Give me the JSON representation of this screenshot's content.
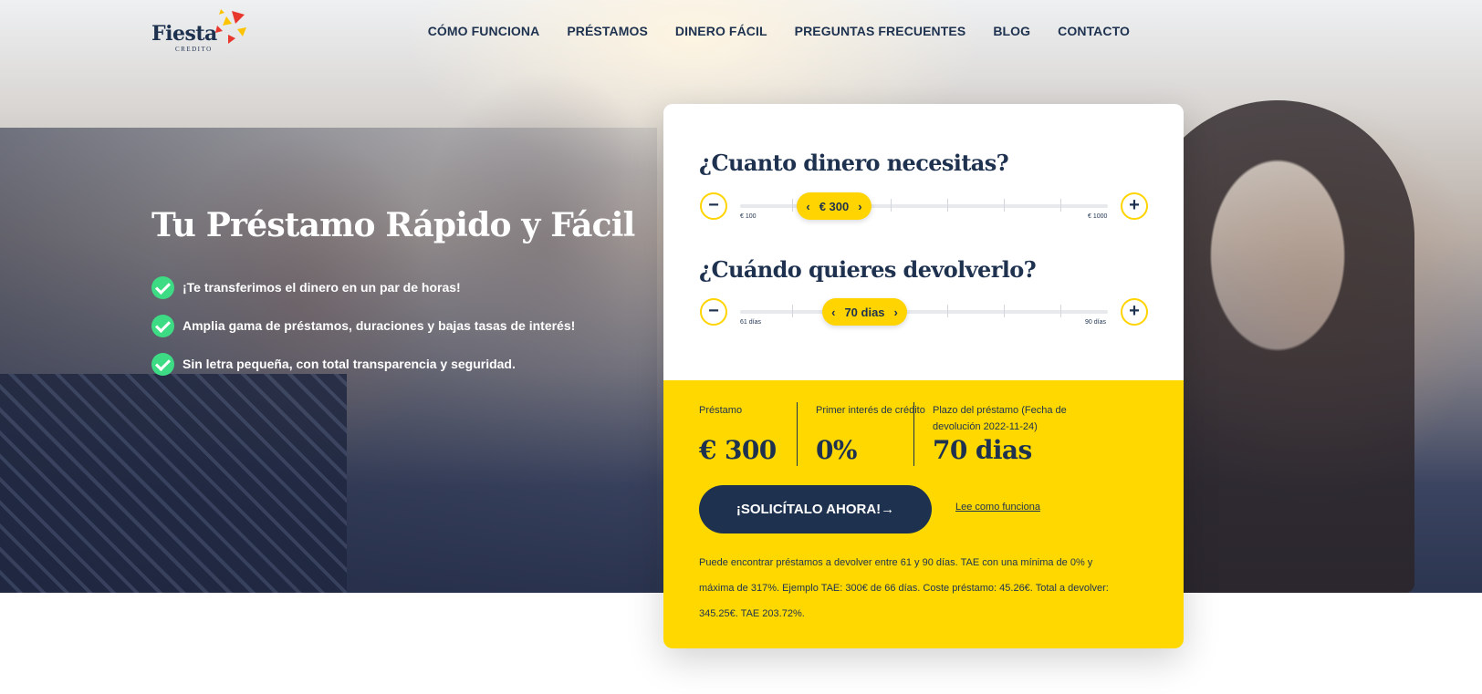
{
  "brand": {
    "name": "Fiesta",
    "subtitle": "CREDITO"
  },
  "nav": [
    {
      "label": "CÓMO FUNCIONA"
    },
    {
      "label": "PRÉSTAMOS"
    },
    {
      "label": "DINERO FÁCIL"
    },
    {
      "label": "PREGUNTAS FRECUENTES"
    },
    {
      "label": "BLOG"
    },
    {
      "label": "CONTACTO"
    }
  ],
  "hero": {
    "title": "Tu Préstamo Rápido y Fácil",
    "features": [
      "¡Te transferimos el dinero en un par de horas!",
      "Amplia gama de préstamos, duraciones y bajas tasas de interés!",
      "Sin letra pequeña, con total transparencia y seguridad."
    ]
  },
  "calculator": {
    "amount": {
      "question": "¿Cuanto dinero necesitas?",
      "value_label": "€ 300",
      "min_label": "€ 100",
      "max_label": "€ 1000",
      "minus": "−",
      "plus": "+",
      "value": 300,
      "min": 100,
      "max": 1000
    },
    "term": {
      "question": "¿Cuándo quieres devolverlo?",
      "value_label": "70 dias",
      "min_label": "61 días",
      "max_label": "90 días",
      "minus": "−",
      "plus": "+",
      "value": 70,
      "min": 61,
      "max": 90
    },
    "summary": {
      "loan_label": "Préstamo",
      "loan_value": "€ 300",
      "interest_label": "Primer interés de crédito",
      "interest_value": "0%",
      "term_label": "Plazo del préstamo (Fecha de devolución 2022-11-24)",
      "term_value": "70 dias"
    },
    "cta_label": "¡SOLICÍTALO AHORA!→",
    "link_label": "Lee como funciona",
    "disclaimer": "Puede encontrar préstamos a devolver entre 61 y 90 días. TAE con una mínima de 0% y máxima de 317%. Ejemplo TAE: 300€ de 66 días. Coste préstamo: 45.26€. Total a devolver: 345.25€. TAE 203.72%."
  },
  "colors": {
    "navy": "#1e3250",
    "yellow": "#ffd800",
    "green": "#3ddc84",
    "confetti_red": "#e8372c",
    "confetti_yellow": "#ffc400"
  }
}
